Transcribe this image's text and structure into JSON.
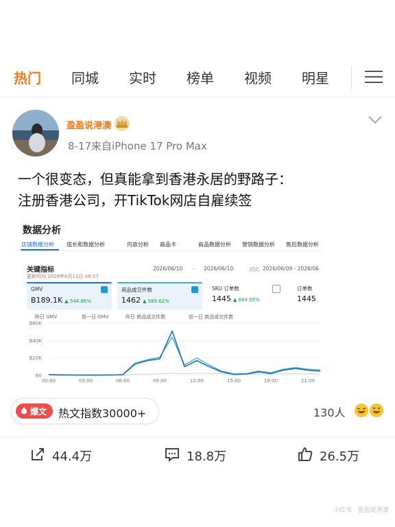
{
  "nav": {
    "tabs": [
      "热门",
      "同城",
      "实时",
      "榜单",
      "视频",
      "明星"
    ],
    "active_index": 0,
    "menu_icon": "menu-icon"
  },
  "post": {
    "username": "盈盈说港澳",
    "meta": "8-17来自iPhone 17 Pro Max",
    "text_line1": "一个很变态，但真能拿到香港永居的野路子：",
    "text_line2": "注册香港公司，开TikTok网店自雇续签"
  },
  "embedded": {
    "title": "数据分析",
    "tabs": [
      "店铺数据分析",
      "成长和数据分析",
      "内容分析",
      "商品卡",
      "商品数据分析",
      "营销数据分析",
      "售后数据分析"
    ],
    "kpi_title": "关键指标",
    "update_time": "更新时间    2026年6月11日 08:57",
    "date_range": "2026/06/10",
    "date_sep": "-",
    "date_range_end": "2026/06/10",
    "compare_label": "对比",
    "compare_range": "2026/06/09 - 2026/06",
    "kpis": [
      {
        "name": "GMV",
        "value": "B189.1K",
        "change": "▲ 544.86%",
        "checked": true
      },
      {
        "name": "商品成交件数",
        "value": "1462",
        "change": "▲ 589.62%",
        "checked": true
      },
      {
        "name": "SKU 订单数",
        "value": "1445",
        "change": "▲ 664.55%",
        "checked": false
      },
      {
        "name": "订单数",
        "value": "1445",
        "change": "",
        "checked": false
      }
    ],
    "legend": [
      "昨日 GMV",
      "前一日 GMV",
      "昨日 商品成交件数",
      "前一日 商品成交件数"
    ],
    "colors": {
      "accent": "#1a73e8",
      "series_gmv": "#1f6fb5",
      "series_units": "#3bb3c9",
      "prev": "#c9ccd1"
    }
  },
  "chart_data": {
    "type": "line",
    "x": [
      "00:00",
      "01:00",
      "02:00",
      "03:00",
      "04:00",
      "05:00",
      "06:00",
      "07:00",
      "08:00",
      "09:00",
      "10:00",
      "11:00",
      "12:00",
      "13:00",
      "14:00",
      "15:00",
      "16:00",
      "17:00",
      "18:00",
      "19:00",
      "20:00",
      "21:00",
      "22:00"
    ],
    "x_tick_labels": [
      "00:00",
      "03:00",
      "06:00",
      "09:00",
      "12:00",
      "15:00",
      "18:00",
      "21:00"
    ],
    "y_tick_labels": [
      "B60K",
      "B40K",
      "B20K",
      "B0"
    ],
    "ylim": [
      0,
      60000
    ],
    "series": [
      {
        "name": "昨日 GMV",
        "values": [
          800,
          500,
          400,
          300,
          300,
          400,
          700,
          13000,
          17000,
          19000,
          51000,
          10000,
          17000,
          10000,
          4000,
          1000,
          1500,
          4000,
          2000,
          6000,
          8000,
          6000,
          5000
        ]
      },
      {
        "name": "昨日 商品成交件数",
        "values": [
          1000,
          700,
          500,
          400,
          400,
          500,
          900,
          14000,
          18000,
          21000,
          44000,
          12000,
          20000,
          12000,
          5000,
          1500,
          2000,
          5000,
          3000,
          7000,
          9000,
          7000,
          6000
        ]
      },
      {
        "name": "前一日 GMV",
        "values": [
          500,
          400,
          300,
          200,
          200,
          300,
          500,
          1200,
          1500,
          1800,
          2200,
          2000,
          2500,
          2200,
          1800,
          1500,
          1400,
          1600,
          1500,
          1700,
          1800,
          1600,
          1500
        ]
      }
    ],
    "grid": true,
    "legend_position": "top-left"
  },
  "bottom": {
    "hot_badge": "爆文",
    "hot_text": "热文指数30000+",
    "readers": "130人",
    "repost": "44.4万",
    "comment": "18.8万",
    "like": "26.5万",
    "watermark": "小红书 · 盈盈说港澳"
  }
}
